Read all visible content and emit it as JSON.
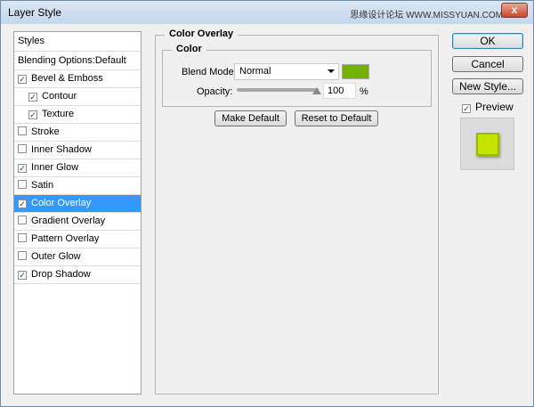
{
  "window": {
    "title": "Layer Style",
    "watermark": "思缘设计论坛 WWW.MISSYUAN.COM",
    "close": "x"
  },
  "sidebar": {
    "header": "Styles",
    "blending": "Blending Options:Default",
    "items": [
      {
        "label": "Bevel & Emboss",
        "checked": true,
        "indent": false
      },
      {
        "label": "Contour",
        "checked": true,
        "indent": true
      },
      {
        "label": "Texture",
        "checked": true,
        "indent": true
      },
      {
        "label": "Stroke",
        "checked": false,
        "indent": false
      },
      {
        "label": "Inner Shadow",
        "checked": false,
        "indent": false
      },
      {
        "label": "Inner Glow",
        "checked": true,
        "indent": false
      },
      {
        "label": "Satin",
        "checked": false,
        "indent": false
      },
      {
        "label": "Color Overlay",
        "checked": true,
        "indent": false,
        "selected": true
      },
      {
        "label": "Gradient Overlay",
        "checked": false,
        "indent": false
      },
      {
        "label": "Pattern Overlay",
        "checked": false,
        "indent": false
      },
      {
        "label": "Outer Glow",
        "checked": false,
        "indent": false
      },
      {
        "label": "Drop Shadow",
        "checked": true,
        "indent": false
      }
    ]
  },
  "panel": {
    "title": "Color Overlay",
    "group": "Color",
    "blend_label": "Blend Mode:",
    "blend_value": "Normal",
    "color": "#74b100",
    "opacity_label": "Opacity:",
    "opacity_value": "100",
    "opacity_unit": "%",
    "make_default": "Make Default",
    "reset_default": "Reset to Default"
  },
  "actions": {
    "ok": "OK",
    "cancel": "Cancel",
    "new_style": "New Style...",
    "preview_label": "Preview",
    "preview_checked": true,
    "check": "✓"
  }
}
